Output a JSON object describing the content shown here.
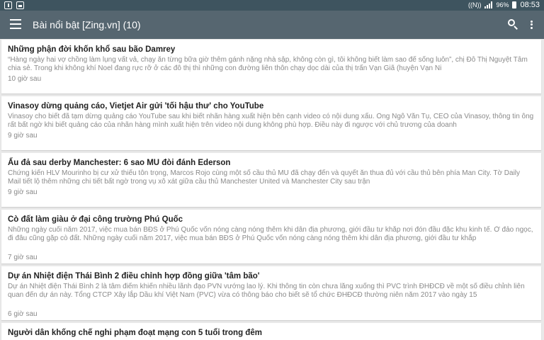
{
  "status_bar": {
    "battery": "96%",
    "time": "08:53"
  },
  "app_bar": {
    "title": "Bài nổi bật [Zing.vn] (10)"
  },
  "articles": [
    {
      "title": "Những phận đời khốn khổ sau bão Damrey",
      "desc": "“Hàng ngày hai vợ chồng làm lụng vất vả, chạy ăn từng bữa giờ thêm gánh nặng nhà sập, không còn gì, tôi không biết làm sao để sống luôn”, chị Đỗ Thị Nguyệt Tâm chia sẻ. Trong khi không khí Noel đang rực rỡ ở các đô thị thì những con đường liên thôn chạy dọc dài của thị trấn Vạn Giã (huyện Vạn Ni",
      "time": "10 giờ sau"
    },
    {
      "title": "Vinasoy dừng quảng cáo, Vietjet Air gửi 'tối hậu thư' cho YouTube",
      "desc": "Vinasoy cho biết đã tạm dừng quảng cáo YouTube sau khi biết nhãn hàng xuất hiện bên cạnh video có nội dung xấu. Ông Ngô Văn Tụ, CEO của Vinasoy, thông tin ông rất bất ngờ khi biết quảng cáo của nhãn hàng mình xuất hiện trên video nội dung không phù hợp. Điều này đi ngược với chủ trương của doanh",
      "time": "9 giờ sau"
    },
    {
      "title": "Ẩu đả sau derby Manchester: 6 sao MU đòi đánh Ederson",
      "desc": "Chứng kiến HLV Mourinho bị cư xử thiếu tôn trọng, Marcos Rojo cùng một số cầu thủ MU đã chạy đến và quyết ăn thua đủ với cầu thủ bên phía Man City. Tờ Daily Mail tiết lộ thêm những chi tiết bất ngờ trong vụ xô xát giữa cầu thủ Manchester United và Manchester City sau trận",
      "time": "9 giờ sau"
    },
    {
      "title": "Cò đất làm giàu ở đại công trường Phú Quốc",
      "desc": "Những ngày cuối năm 2017, việc mua bán BĐS ở Phú Quốc vốn nóng càng nóng thêm khi dân địa phương, giới đầu tư khắp nơi đón đầu đặc khu kinh tế. Ở đảo ngọc, đi đâu cũng gặp cò đất. Những ngày cuối năm 2017, việc mua bán BĐS ở Phú Quốc vốn nóng càng nóng thêm khi dân địa phương, giới đầu tư khắp",
      "time": "7 giờ sau"
    },
    {
      "title": "Dự án Nhiệt điện Thái Bình 2 điều chỉnh hợp đồng giữa 'tâm bão'",
      "desc": "Dự án Nhiệt điện Thái Bình 2 là tâm điểm khiến nhiều lãnh đạo PVN vướng lao lý. Khi thông tin còn chưa lắng xuống thì PVC trình ĐHĐCĐ về một số điều chỉnh liên quan đến dự án này. Tổng CTCP Xây lắp Dầu khí Việt Nam (PVC) vừa có thông báo cho biết sẽ tổ chức ĐHĐCĐ thường niên năm 2017 vào ngày 15",
      "time": "6 giờ sau"
    },
    {
      "title": "Người dân khống chế nghi phạm đoạt mạng con 5 tuổi trong đêm",
      "desc": "",
      "time": ""
    }
  ]
}
